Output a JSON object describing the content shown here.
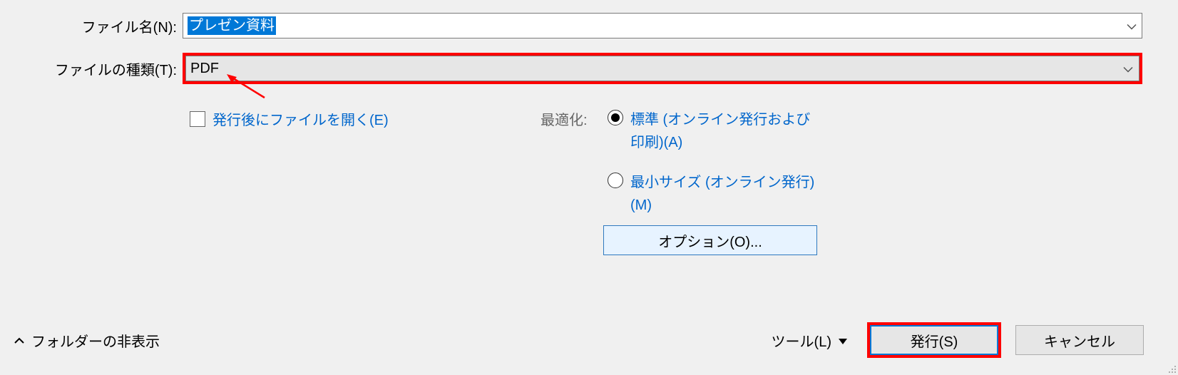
{
  "filename": {
    "label": "ファイル名(N):",
    "value": "プレゼン資料"
  },
  "filetype": {
    "label": "ファイルの種類(T):",
    "value": "PDF"
  },
  "open_after": {
    "label": "発行後にファイルを開く(E)"
  },
  "optimize": {
    "label": "最適化:",
    "standard": "標準 (オンライン発行および印刷)(A)",
    "minimum": "最小サイズ (オンライン発行)(M)"
  },
  "options_button": "オプション(O)...",
  "hide_folders": "フォルダーの非表示",
  "tools": "ツール(L)",
  "publish": "発行(S)",
  "cancel": "キャンセル"
}
